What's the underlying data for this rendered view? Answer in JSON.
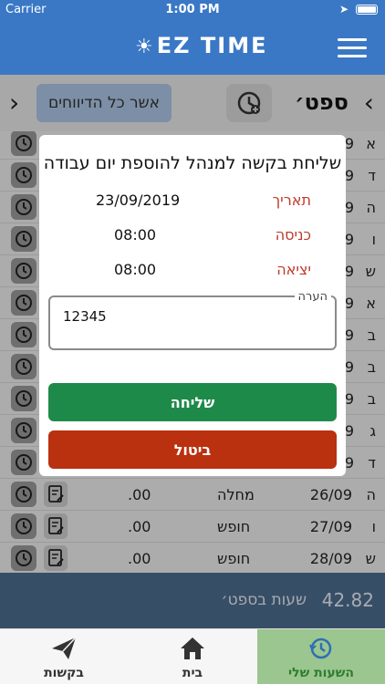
{
  "status_bar": {
    "carrier": "Carrier",
    "time": "1:00 PM"
  },
  "header": {
    "logo_text": "EZ TIME"
  },
  "month_bar": {
    "month": "ספט׳",
    "approve_all_label": "אשר כל הדיווחים"
  },
  "rows": [
    {
      "dow": "א",
      "date": "9",
      "kind": "",
      "hours": ""
    },
    {
      "dow": "ד",
      "date": "9",
      "kind": "",
      "hours": ""
    },
    {
      "dow": "ה",
      "date": "9",
      "kind": "",
      "hours": ""
    },
    {
      "dow": "ו",
      "date": "9",
      "kind": "",
      "hours": ""
    },
    {
      "dow": "ש",
      "date": "9",
      "kind": "",
      "hours": ""
    },
    {
      "dow": "א",
      "date": "9",
      "kind": "",
      "hours": ""
    },
    {
      "dow": "ב",
      "date": "9",
      "kind": "",
      "hours": ""
    },
    {
      "dow": "ב",
      "date": "9",
      "kind": "",
      "hours": ""
    },
    {
      "dow": "ב",
      "date": "9",
      "kind": "",
      "hours": ""
    },
    {
      "dow": "ג",
      "date": "9",
      "kind": "",
      "hours": ""
    },
    {
      "dow": "ד",
      "date": "9",
      "kind": "",
      "hours": ""
    },
    {
      "dow": "ה",
      "date": "26/09",
      "kind": "מחלה",
      "hours": ".00"
    },
    {
      "dow": "ו",
      "date": "27/09",
      "kind": "חופש",
      "hours": ".00"
    },
    {
      "dow": "ש",
      "date": "28/09",
      "kind": "חופש",
      "hours": ".00"
    }
  ],
  "summary": {
    "total": "42.82",
    "label": "שעות בספט׳"
  },
  "modal": {
    "title": "שליחת בקשה למנהל להוספת יום עבודה",
    "date_label": "תאריך",
    "date_value": "23/09/2019",
    "entry_label": "כניסה",
    "entry_value": "08:00",
    "exit_label": "יציאה",
    "exit_value": "08:00",
    "comment_label": "הערה",
    "comment_value": "12345",
    "send_label": "שליחה",
    "cancel_label": "ביטול"
  },
  "tabs": [
    {
      "label": "בקשות"
    },
    {
      "label": "בית"
    },
    {
      "label": "השעות שלי"
    }
  ],
  "colors": {
    "header": "#3a78c6",
    "send": "#1e8a4a",
    "cancel": "#b9310f",
    "label_red": "#c0392b",
    "active_tab": "#9bc68f"
  }
}
